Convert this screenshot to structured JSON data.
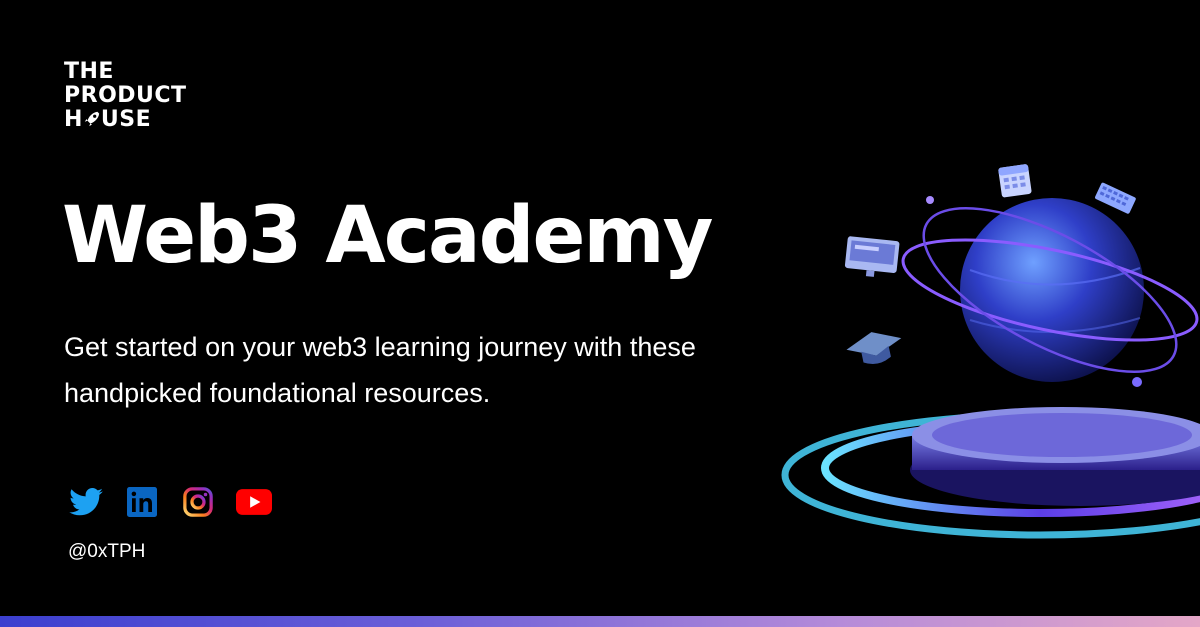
{
  "logo": {
    "line1": "THE",
    "line2": "PRODUCT",
    "line3_pre": "H",
    "line3_post": "USE"
  },
  "title": "Web3 Academy",
  "subtitle": "Get started on your web3 learning journey with these handpicked foundational resources.",
  "socials": [
    {
      "icon": "twitter-icon",
      "color": "#1da1f2"
    },
    {
      "icon": "linkedin-icon",
      "color": "#0a66c2"
    },
    {
      "icon": "instagram-icon",
      "color": "#e1306c"
    },
    {
      "icon": "youtube-icon",
      "color": "#ff0000"
    }
  ],
  "handle": "@0xTPH",
  "colors": {
    "background": "#000000",
    "text": "#ffffff",
    "accent_blue": "#3b3fcf",
    "accent_pink": "#e4a6c7"
  }
}
